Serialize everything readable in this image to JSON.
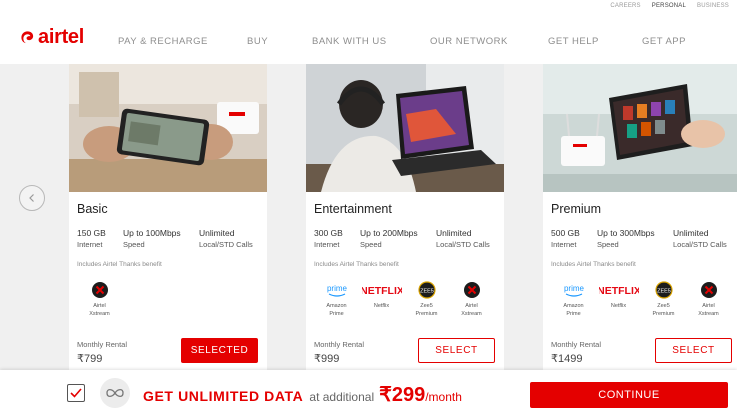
{
  "header": {
    "toplinks": [
      "CAREERS",
      "PERSONAL",
      "BUSINESS"
    ],
    "brand": "airtel",
    "nav": [
      "PAY & RECHARGE",
      "BUY",
      "BANK WITH US",
      "OUR NETWORK",
      "GET HELP",
      "GET APP"
    ]
  },
  "plans": [
    {
      "name": "Basic",
      "specs": [
        {
          "value": "150 GB",
          "label": "Internet"
        },
        {
          "value": "Up to 100Mbps",
          "label": "Speed"
        },
        {
          "value": "Unlimited",
          "label": "Local/STD Calls"
        }
      ],
      "note": "Includes Airtel Thanks benefit",
      "benefits": [
        {
          "icon": "xstream-icon",
          "line1": "Airtel",
          "line2": "Xstream"
        }
      ],
      "rental_label": "Monthly Rental",
      "price": "₹799",
      "button": "SELECTED"
    },
    {
      "name": "Entertainment",
      "specs": [
        {
          "value": "300 GB",
          "label": "Internet"
        },
        {
          "value": "Up to 200Mbps",
          "label": "Speed"
        },
        {
          "value": "Unlimited",
          "label": "Local/STD Calls"
        }
      ],
      "note": "Includes Airtel Thanks benefit",
      "benefits": [
        {
          "icon": "prime-icon",
          "line1": "Amazon",
          "line2": "Prime"
        },
        {
          "icon": "netflix-icon",
          "line1": "Netflix",
          "line2": ""
        },
        {
          "icon": "zee5-icon",
          "line1": "Zee5",
          "line2": "Premium"
        },
        {
          "icon": "xstream-icon",
          "line1": "Airtel",
          "line2": "Xstream"
        }
      ],
      "rental_label": "Monthly Rental",
      "price": "₹999",
      "button": "SELECT"
    },
    {
      "name": "Premium",
      "specs": [
        {
          "value": "500 GB",
          "label": "Internet"
        },
        {
          "value": "Up to 300Mbps",
          "label": "Speed"
        },
        {
          "value": "Unlimited",
          "label": "Local/STD Calls"
        }
      ],
      "note": "Includes Airtel Thanks benefit",
      "benefits": [
        {
          "icon": "prime-icon",
          "line1": "Amazon",
          "line2": "Prime"
        },
        {
          "icon": "netflix-icon",
          "line1": "Netflix",
          "line2": ""
        },
        {
          "icon": "zee5-icon",
          "line1": "Zee5",
          "line2": "Premium"
        },
        {
          "icon": "xstream-icon",
          "line1": "Airtel",
          "line2": "Xstream"
        }
      ],
      "rental_label": "Monthly Rental",
      "price": "₹1499",
      "button": "SELECT"
    }
  ],
  "icons": {
    "netflix_text": "NETFLIX",
    "prime_text": "prime",
    "zee5_text": "ZEE5"
  },
  "bottom_bar": {
    "checked": true,
    "promo_bold": "GET UNLIMITED DATA",
    "promo_mid": "at additional",
    "amount": "₹299",
    "period": "/month",
    "continue": "CONTINUE"
  },
  "colors": {
    "brand": "#e40000"
  }
}
